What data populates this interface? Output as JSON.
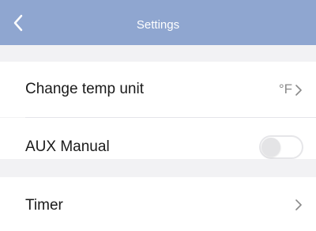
{
  "header": {
    "title": "Settings",
    "back_icon": "chevron-left-icon"
  },
  "settings": {
    "temp_unit": {
      "label": "Change temp unit",
      "value": "°F"
    },
    "aux_manual": {
      "label": "AUX Manual",
      "enabled": false
    },
    "timer": {
      "label": "Timer"
    }
  },
  "colors": {
    "navbar": "#8fa6d0",
    "background": "#f2f2f4"
  }
}
